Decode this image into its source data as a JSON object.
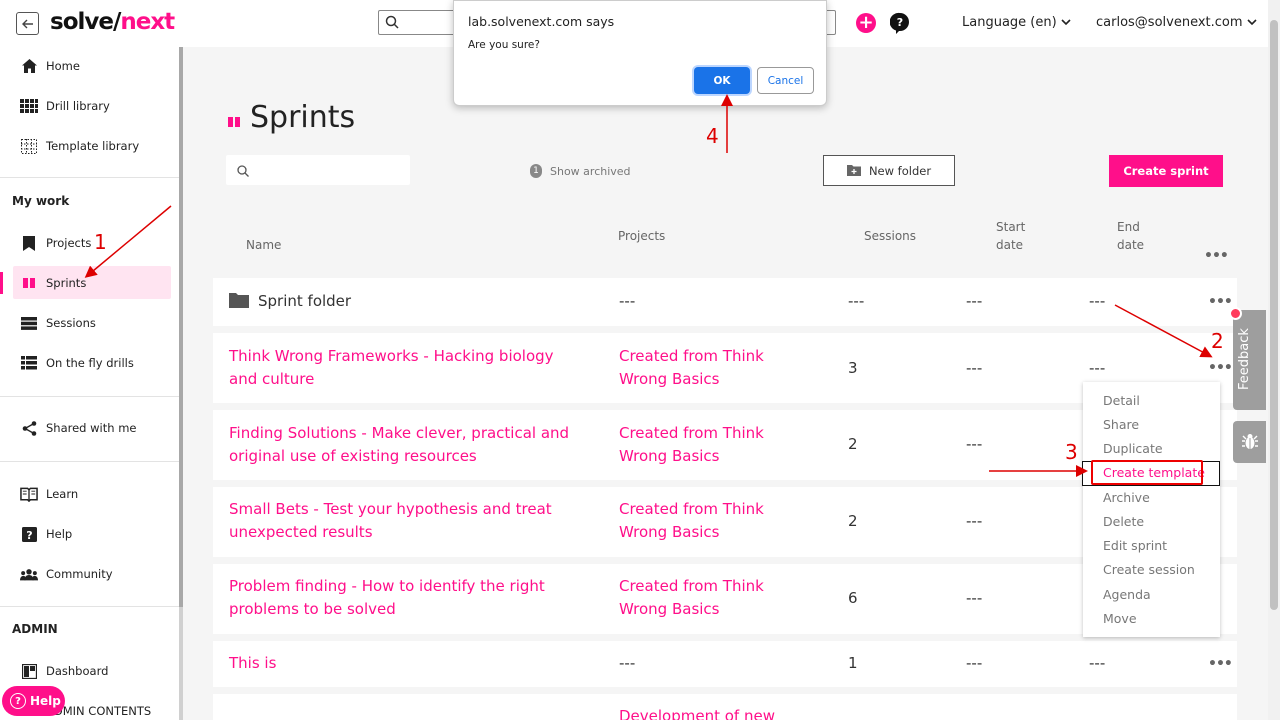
{
  "header": {
    "logo_part1": "solve/",
    "logo_part2": "next",
    "language": "Language (en)",
    "user": "carlos@solvenext.com"
  },
  "sidebar": {
    "items_top": [
      {
        "label": "Home",
        "icon": "home-icon"
      },
      {
        "label": "Drill library",
        "icon": "grid-icon"
      },
      {
        "label": "Template library",
        "icon": "dotted-grid-icon"
      }
    ],
    "my_work_title": "My work",
    "my_work": [
      {
        "label": "Projects",
        "icon": "bookmark-icon"
      },
      {
        "label": "Sprints",
        "icon": "sprint-icon"
      },
      {
        "label": "Sessions",
        "icon": "sessions-icon"
      },
      {
        "label": "On the fly drills",
        "icon": "list-icon"
      }
    ],
    "shared": {
      "label": "Shared with me",
      "icon": "share-icon"
    },
    "support": [
      {
        "label": "Learn",
        "icon": "book-icon"
      },
      {
        "label": "Help",
        "icon": "help-icon"
      },
      {
        "label": "Community",
        "icon": "community-icon"
      }
    ],
    "admin_title": "ADMIN",
    "admin": [
      {
        "label": "Dashboard",
        "icon": "dashboard-icon"
      },
      {
        "label": "ADMIN CONTENTS",
        "icon": "contents-icon"
      }
    ],
    "help_pill": "Help"
  },
  "main": {
    "title": "Sprints",
    "archived_count": "1",
    "show_archived": "Show archived",
    "new_folder": "New folder",
    "create_sprint": "Create sprint",
    "columns": {
      "name": "Name",
      "projects": "Projects",
      "sessions": "Sessions",
      "start_1": "Start",
      "start_2": "date",
      "end_1": "End",
      "end_2": "date"
    },
    "folder": {
      "name": "Sprint folder",
      "projects": "---",
      "sessions": "---",
      "start": "---",
      "end": "---"
    },
    "rows": [
      {
        "name_1": "Think Wrong Frameworks - Hacking biology",
        "name_2": "and culture",
        "proj_1": "Created from Think",
        "proj_2": "Wrong Basics",
        "sessions": "3",
        "start": "---",
        "end": "---"
      },
      {
        "name_1": "Finding Solutions - Make clever, practical and",
        "name_2": "original use of existing resources",
        "proj_1": "Created from Think",
        "proj_2": "Wrong Basics",
        "sessions": "2",
        "start": "---",
        "end": ""
      },
      {
        "name_1": "Small Bets - Test your hypothesis and treat",
        "name_2": "unexpected results",
        "proj_1": "Created from Think",
        "proj_2": "Wrong Basics",
        "sessions": "2",
        "start": "---",
        "end": ""
      },
      {
        "name_1": "Problem finding - How to identify the right",
        "name_2": "problems to be solved",
        "proj_1": "Created from Think",
        "proj_2": "Wrong Basics",
        "sessions": "6",
        "start": "---",
        "end": ""
      },
      {
        "name_1": "This is",
        "name_2": "",
        "proj_1": "---",
        "proj_2": "",
        "sessions": "1",
        "start": "---",
        "end": "---"
      },
      {
        "name_1": "",
        "name_2": "",
        "proj_1": "Development of new",
        "proj_2": "",
        "sessions": "",
        "start": "",
        "end": ""
      }
    ]
  },
  "context_menu": [
    "Detail",
    "Share",
    "Duplicate",
    "Create template",
    "Archive",
    "Delete",
    "Edit sprint",
    "Create session",
    "Agenda",
    "Move"
  ],
  "dialog": {
    "title": "lab.solvenext.com says",
    "message": "Are you sure?",
    "ok": "OK",
    "cancel": "Cancel"
  },
  "feedback": "Feedback",
  "annotations": {
    "a1": "1",
    "a2": "2",
    "a3": "3",
    "a4": "4"
  },
  "colors": {
    "brand": "#ff0f8a",
    "ok_button": "#1a73e8",
    "annotation": "#dd0000"
  }
}
